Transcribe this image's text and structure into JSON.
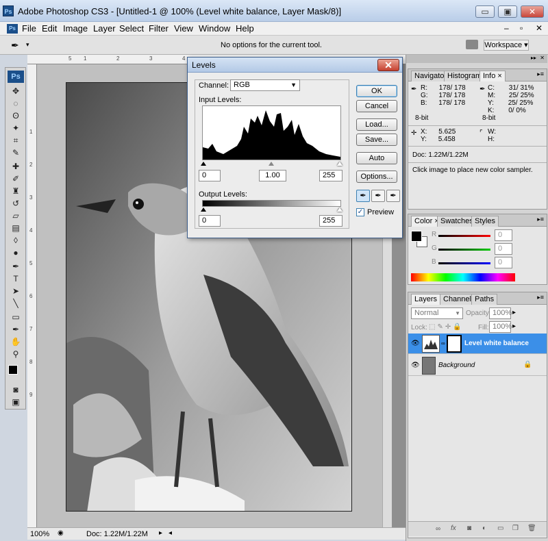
{
  "app": {
    "title": "Adobe Photoshop CS3 - [Untitled-1 @ 100% (Level white balance, Layer Mask/8)]",
    "icon": "Ps"
  },
  "window_buttons": {
    "minimize": "▭",
    "restore": "▣",
    "close": "✕"
  },
  "doc_buttons": {
    "minimize": "–",
    "restore": "▫",
    "close": "✕"
  },
  "menu": [
    "File",
    "Edit",
    "Image",
    "Layer",
    "Select",
    "Filter",
    "View",
    "Window",
    "Help"
  ],
  "options": {
    "message": "No options for the current tool.",
    "workspace": "Workspace ▾"
  },
  "ruler": {
    "h": [
      "5",
      "1",
      "2",
      "3",
      "4"
    ],
    "v": [
      "1",
      "2",
      "3",
      "4",
      "5",
      "6",
      "7",
      "8",
      "9"
    ]
  },
  "status": {
    "zoom": "100%",
    "doc": "Doc: 1.22M/1.22M"
  },
  "levels": {
    "title": "Levels",
    "channel_label": "Channel:",
    "channel_value": "RGB",
    "input_label": "Input Levels:",
    "input_values": [
      "0",
      "1.00",
      "255"
    ],
    "output_label": "Output Levels:",
    "output_values": [
      "0",
      "255"
    ],
    "buttons": {
      "ok": "OK",
      "cancel": "Cancel",
      "load": "Load...",
      "save": "Save...",
      "auto": "Auto",
      "options": "Options..."
    },
    "preview_label": "Preview",
    "preview_checked": "✓"
  },
  "info": {
    "tabs": [
      "Navigator",
      "Histogram",
      "Info ×"
    ],
    "rgb": {
      "r": "178/ 178",
      "g": "178/ 178",
      "b": "178/ 178"
    },
    "cmyk": {
      "c": "31/ 31%",
      "m": "25/ 25%",
      "y": "25/ 25%",
      "k": "0/ 0%"
    },
    "bit_left": "8-bit",
    "bit_right": "8-bit",
    "x": "5.625",
    "y": "5.458",
    "doc": "Doc: 1.22M/1.22M",
    "hint": "Click image to place new color sampler."
  },
  "color": {
    "tabs": [
      "Color ×",
      "Swatches",
      "Styles"
    ],
    "r": "0",
    "g": "0",
    "b": "0"
  },
  "layers": {
    "tabs": [
      "Layers ×",
      "Channels",
      "Paths"
    ],
    "blend": "Normal",
    "opacity_label": "Opacity:",
    "opacity": "100%",
    "lock_label": "Lock:",
    "fill_label": "Fill:",
    "fill": "100%",
    "items": [
      {
        "name": "Level white balance"
      },
      {
        "name": "Background"
      }
    ]
  }
}
